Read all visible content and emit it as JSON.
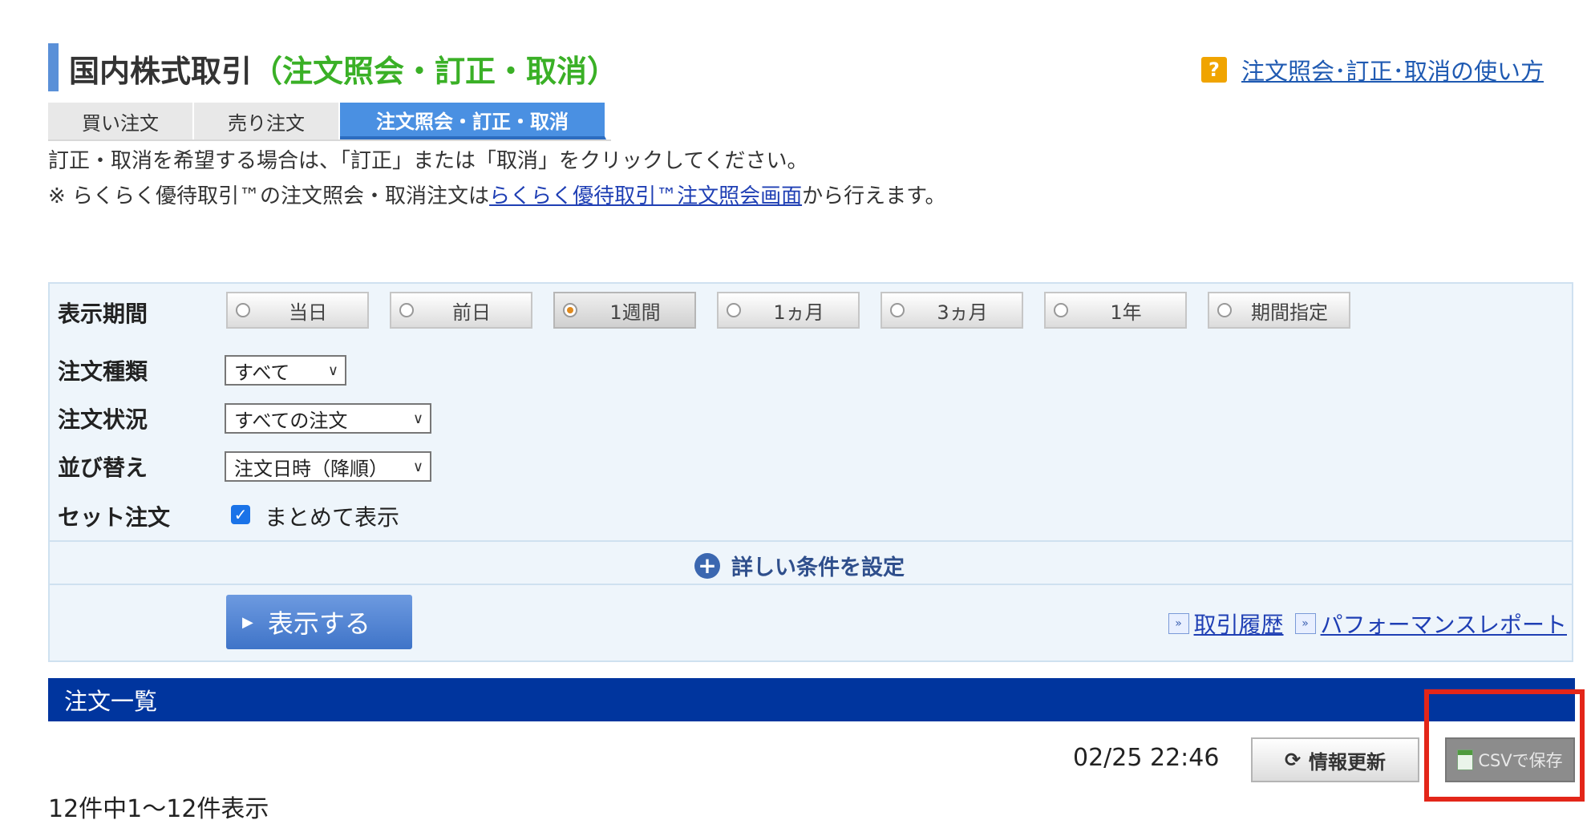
{
  "header": {
    "title_main": "国内株式取引",
    "title_sub": "（注文照会・訂正・取消）",
    "help_label": "注文照会･訂正･取消の使い方"
  },
  "tabs": [
    {
      "label": "買い注文",
      "active": false
    },
    {
      "label": "売り注文",
      "active": false
    },
    {
      "label": "注文照会・訂正・取消",
      "active": true
    }
  ],
  "intro": {
    "line1": "訂正・取消を希望する場合は、「訂正」または「取消」をクリックしてください。",
    "line2_prefix": "※ らくらく優待取引™の注文照会・取消注文は",
    "line2_link": "らくらく優待取引™注文照会画面",
    "line2_suffix": "から行えます。"
  },
  "filters": {
    "period": {
      "label": "表示期間",
      "options": [
        "当日",
        "前日",
        "1週間",
        "1ヵ月",
        "3ヵ月",
        "1年",
        "期間指定"
      ],
      "selected": "1週間"
    },
    "order_type": {
      "label": "注文種類",
      "value": "すべて"
    },
    "order_status": {
      "label": "注文状況",
      "value": "すべての注文"
    },
    "sort": {
      "label": "並び替え",
      "value": "注文日時（降順）"
    },
    "set_order": {
      "label": "セット注文",
      "checkbox_label": "まとめて表示",
      "checked": true
    },
    "advanced_label": "詳しい条件を設定",
    "show_button": "表示する",
    "links": [
      "取引履歴",
      "パフォーマンスレポート"
    ]
  },
  "order_list": {
    "title": "注文一覧",
    "timestamp": "02/25 22:46",
    "refresh_label": "情報更新",
    "csv_label": "CSVで保存",
    "count_text": "12件中1～12件表示"
  },
  "colors": {
    "accent_blue": "#4a90e2",
    "header_navy": "#00359e",
    "title_green": "#3ab026",
    "highlight_red": "#e32619"
  }
}
